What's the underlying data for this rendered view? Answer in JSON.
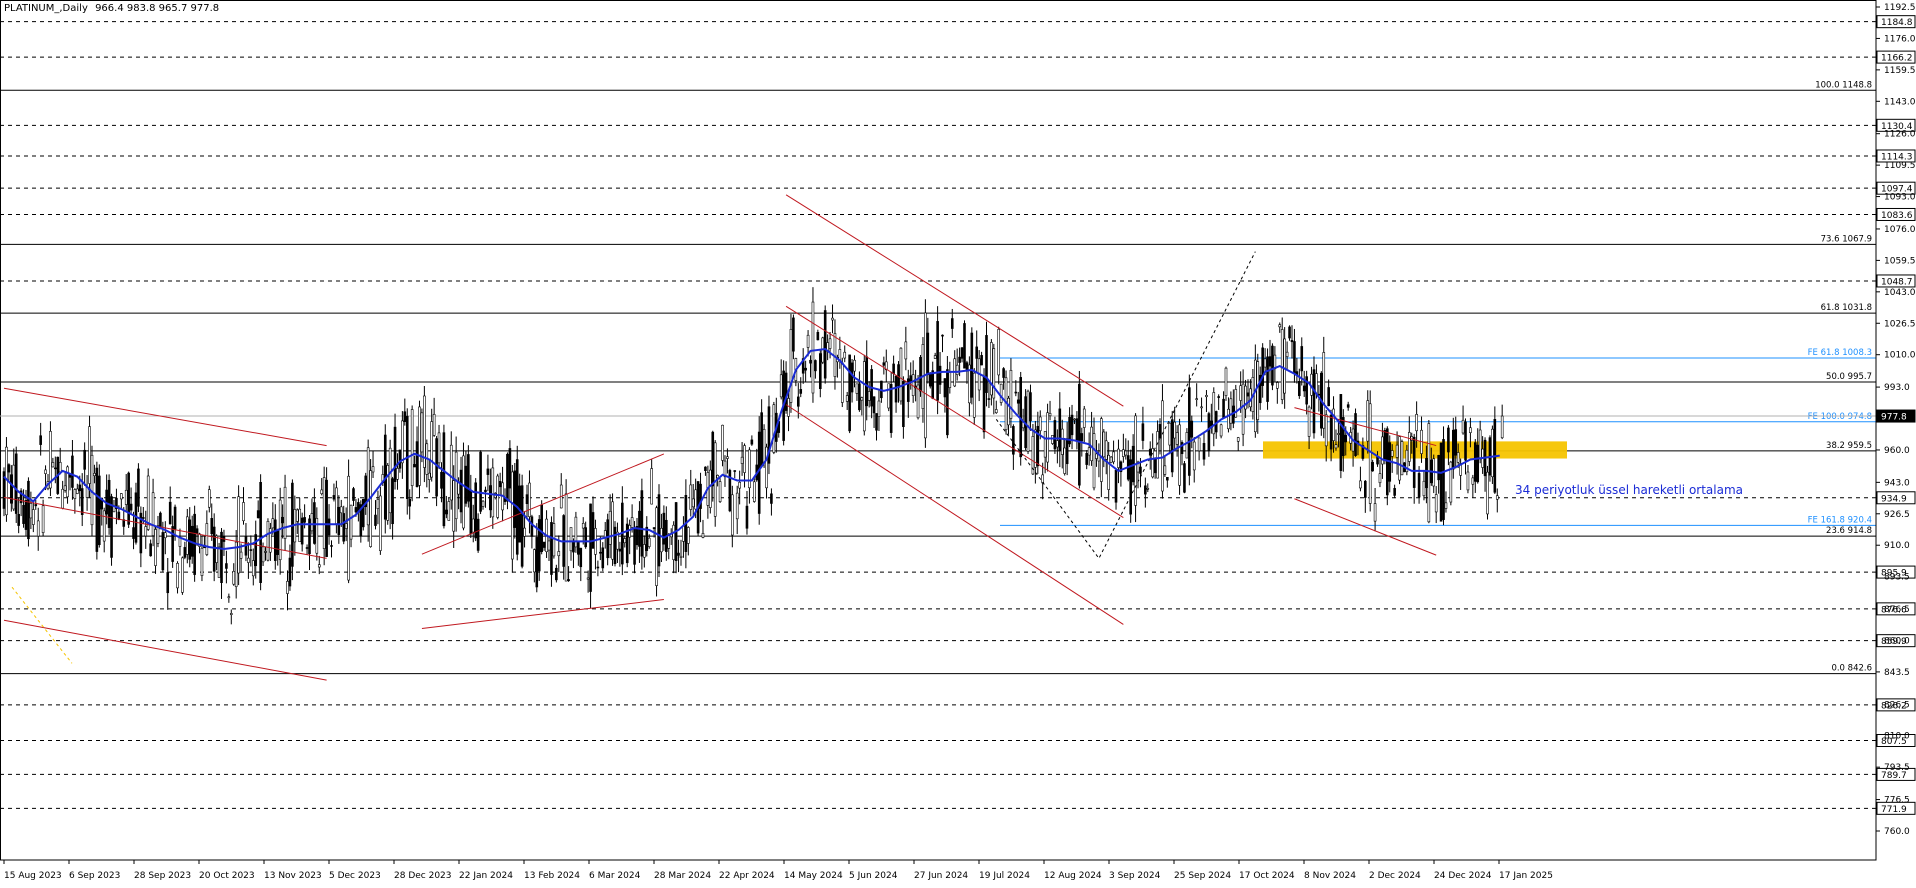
{
  "header": {
    "symbol": "PLATINUM_,Daily",
    "ohlc": "966.4 983.8 965.7 977.8"
  },
  "annotation": {
    "ema_label": "34 periyotluk üssel hareketli ortalama"
  },
  "colors": {
    "background": "#ffffff",
    "candle": "#000000",
    "ema": "#1a2bd6",
    "channel": "#c0181f",
    "fe_levels": "#1e90ff",
    "zone": "#f5c400",
    "fib_levels": "#000000"
  },
  "chart_data": {
    "type": "candlestick",
    "symbol": "PLATINUM_",
    "timeframe": "Daily",
    "last_ohlc": {
      "open": 966.4,
      "high": 983.8,
      "low": 965.7,
      "close": 977.8
    },
    "current_price": 977.8,
    "ylim": [
      760.0,
      1192.5
    ],
    "y_ticks": [
      "1192.5",
      "1176.0",
      "1159.5",
      "1143.0",
      "1126.0",
      "1109.5",
      "1093.0",
      "1076.0",
      "1059.5",
      "1043.0",
      "1026.5",
      "1010.0",
      "993.0",
      "976.5",
      "960.0",
      "943.0",
      "926.5",
      "910.0",
      "893.5",
      "876.5",
      "860.0",
      "843.5",
      "826.5",
      "810.0",
      "793.5",
      "776.5",
      "760.0"
    ],
    "x_ticks": [
      "15 Aug 2023",
      "6 Sep 2023",
      "28 Sep 2023",
      "20 Oct 2023",
      "13 Nov 2023",
      "5 Dec 2023",
      "28 Dec 2023",
      "22 Jan 2024",
      "13 Feb 2024",
      "6 Mar 2024",
      "28 Mar 2024",
      "22 Apr 2024",
      "14 May 2024",
      "5 Jun 2024",
      "27 Jun 2024",
      "19 Jul 2024",
      "12 Aug 2024",
      "3 Sep 2024",
      "25 Sep 2024",
      "17 Oct 2024",
      "8 Nov 2024",
      "2 Dec 2024",
      "24 Dec 2024",
      "17 Jan 2025"
    ],
    "price_labels": [
      1184.8,
      1166.2,
      1130.4,
      1114.3,
      1097.4,
      1083.6,
      1048.7,
      977.8,
      934.9,
      895.9,
      876.6,
      859.9,
      826.2,
      807.5,
      789.7,
      771.9
    ],
    "fibonacci": [
      {
        "label": "100.0 1148.8",
        "price": 1148.8
      },
      {
        "label": "73.6 1067.9",
        "price": 1067.9
      },
      {
        "label": "61.8 1031.8",
        "price": 1031.8
      },
      {
        "label": "50.0 995.7",
        "price": 995.7
      },
      {
        "label": "38.2 959.5",
        "price": 959.5
      },
      {
        "label": "23.6 914.8",
        "price": 914.8
      },
      {
        "label": "0.0 842.6",
        "price": 842.6
      }
    ],
    "fib_expansion": [
      {
        "label": "FE 61.8 1008.3",
        "price": 1008.3
      },
      {
        "label": "FE 100.0 974.8",
        "price": 974.8
      },
      {
        "label": "FE 161.8 920.4",
        "price": 920.4
      }
    ],
    "support_zone": {
      "price_low": 955.5,
      "price_high": 964.5
    },
    "ema": {
      "name": "34 periyotluk üssel hareketli ortalama",
      "period": 34,
      "points": [
        [
          0,
          946
        ],
        [
          12,
          938
        ],
        [
          24,
          933
        ],
        [
          36,
          942
        ],
        [
          48,
          949
        ],
        [
          60,
          946
        ],
        [
          72,
          938
        ],
        [
          84,
          932
        ],
        [
          96,
          929
        ],
        [
          108,
          925
        ],
        [
          120,
          921
        ],
        [
          132,
          918
        ],
        [
          144,
          914
        ],
        [
          156,
          911
        ],
        [
          168,
          909
        ],
        [
          180,
          908
        ],
        [
          192,
          909
        ],
        [
          204,
          911
        ],
        [
          216,
          916
        ],
        [
          228,
          919
        ],
        [
          240,
          921
        ],
        [
          252,
          921
        ],
        [
          264,
          921
        ],
        [
          276,
          921
        ],
        [
          288,
          926
        ],
        [
          300,
          935
        ],
        [
          312,
          945
        ],
        [
          324,
          954
        ],
        [
          336,
          958
        ],
        [
          348,
          955
        ],
        [
          360,
          949
        ],
        [
          372,
          943
        ],
        [
          384,
          938
        ],
        [
          396,
          937
        ],
        [
          408,
          936
        ],
        [
          420,
          930
        ],
        [
          432,
          921
        ],
        [
          444,
          915
        ],
        [
          456,
          912
        ],
        [
          468,
          912
        ],
        [
          480,
          912
        ],
        [
          492,
          914
        ],
        [
          504,
          916
        ],
        [
          516,
          919
        ],
        [
          528,
          918
        ],
        [
          540,
          914
        ],
        [
          552,
          918
        ],
        [
          564,
          925
        ],
        [
          576,
          940
        ],
        [
          588,
          947
        ],
        [
          600,
          944
        ],
        [
          612,
          944
        ],
        [
          624,
          955
        ],
        [
          636,
          980
        ],
        [
          648,
          1002
        ],
        [
          660,
          1012
        ],
        [
          672,
          1013
        ],
        [
          684,
          1007
        ],
        [
          696,
          998
        ],
        [
          708,
          993
        ],
        [
          720,
          991
        ],
        [
          732,
          993
        ],
        [
          744,
          996
        ],
        [
          756,
          1000
        ],
        [
          768,
          1001
        ],
        [
          780,
          1001
        ],
        [
          792,
          1002
        ],
        [
          804,
          998
        ],
        [
          816,
          988
        ],
        [
          828,
          979
        ],
        [
          840,
          971
        ],
        [
          852,
          966
        ],
        [
          864,
          966
        ],
        [
          876,
          965
        ],
        [
          888,
          963
        ],
        [
          900,
          955
        ],
        [
          912,
          949
        ],
        [
          924,
          952
        ],
        [
          936,
          955
        ],
        [
          948,
          956
        ],
        [
          960,
          961
        ],
        [
          972,
          965
        ],
        [
          984,
          970
        ],
        [
          996,
          976
        ],
        [
          1008,
          980
        ],
        [
          1020,
          986
        ],
        [
          1032,
          1001
        ],
        [
          1044,
          1004
        ],
        [
          1056,
          1000
        ],
        [
          1068,
          995
        ],
        [
          1080,
          984
        ],
        [
          1092,
          975
        ],
        [
          1104,
          965
        ],
        [
          1116,
          960
        ],
        [
          1128,
          955
        ],
        [
          1140,
          953
        ],
        [
          1152,
          949
        ],
        [
          1164,
          949
        ],
        [
          1176,
          948
        ],
        [
          1188,
          951
        ],
        [
          1200,
          955
        ],
        [
          1212,
          956
        ],
        [
          1224,
          957
        ]
      ]
    },
    "trendlines": [
      {
        "from": [
          0,
          992.4
        ],
        "to": [
          264,
          962.3
        ]
      },
      {
        "from": [
          0,
          935.1
        ],
        "to": [
          264,
          903.1
        ]
      },
      {
        "from": [
          0,
          870.6
        ],
        "to": [
          264,
          839.2
        ]
      },
      {
        "from": [
          342,
          905.3
        ],
        "to": [
          540,
          957.9
        ]
      },
      {
        "from": [
          342,
          866.3
        ],
        "to": [
          540,
          881.5
        ]
      },
      {
        "from": [
          640,
          1093.9
        ],
        "to": [
          916,
          983.0
        ]
      },
      {
        "from": [
          640,
          1035.4
        ],
        "to": [
          916,
          924.5
        ]
      },
      {
        "from": [
          640,
          983.8
        ],
        "to": [
          916,
          868.4
        ]
      },
      {
        "from": [
          1056,
          982.2
        ],
        "to": [
          1172,
          962.3
        ]
      },
      {
        "from": [
          1056,
          934.4
        ],
        "to": [
          1172,
          904.8
        ]
      }
    ],
    "zigzag": [
      [
        812,
        976.1
      ],
      [
        896,
        903.1
      ],
      [
        1024,
        1064.1
      ]
    ]
  }
}
